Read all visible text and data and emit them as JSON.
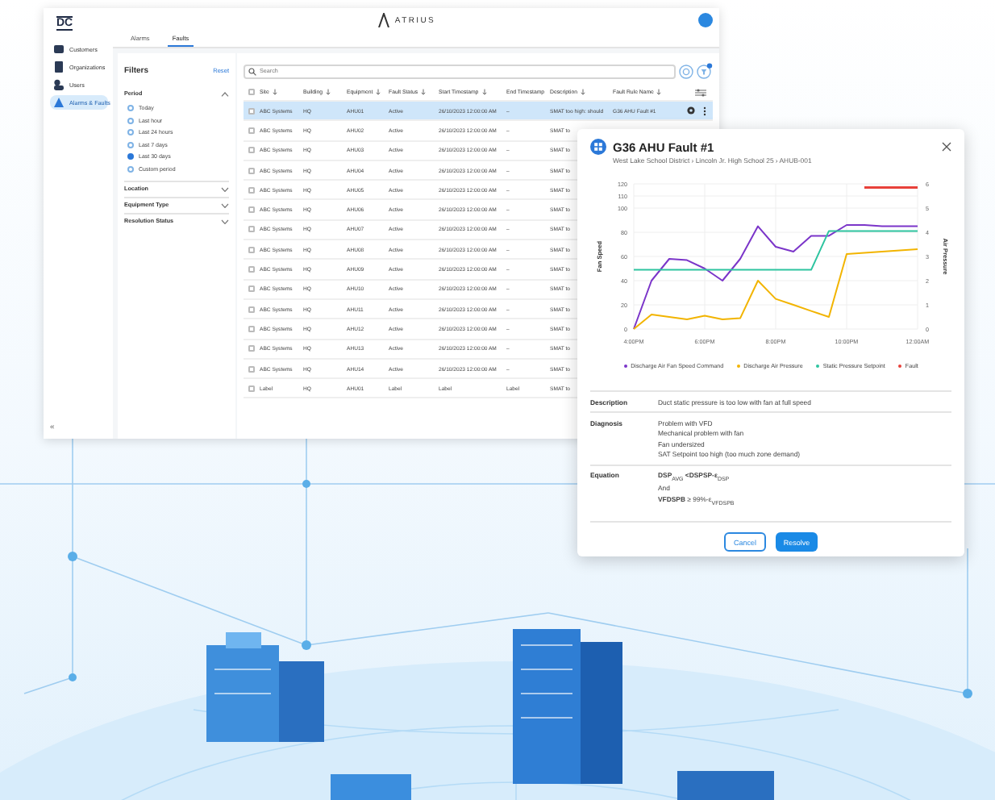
{
  "app": {
    "logo": "DC",
    "brand": "ATRIUS",
    "sidebar": {
      "items": [
        {
          "label": "Customers",
          "selected": false
        },
        {
          "label": "Organizations",
          "selected": false
        },
        {
          "label": "Users",
          "selected": false
        },
        {
          "label": "Alarms & Faults",
          "selected": true
        }
      ],
      "collapse": "«"
    },
    "tabs": [
      {
        "label": "Alarms",
        "selected": false
      },
      {
        "label": "Faults",
        "selected": true
      }
    ],
    "filters": {
      "title": "Filters",
      "reset": "Reset",
      "period": {
        "label": "Period",
        "expanded": true,
        "options": [
          {
            "label": "Today",
            "selected": false
          },
          {
            "label": "Last hour",
            "selected": false
          },
          {
            "label": "Last 24 hours",
            "selected": false
          },
          {
            "label": "Last 7 days",
            "selected": false
          },
          {
            "label": "Last 30 days",
            "selected": true
          },
          {
            "label": "Custom period",
            "selected": false
          }
        ]
      },
      "sections": [
        {
          "label": "Location",
          "expanded": false
        },
        {
          "label": "Equipment Type",
          "expanded": false
        },
        {
          "label": "Resolution Status",
          "expanded": false
        }
      ]
    },
    "table": {
      "search": {
        "placeholder": "Search"
      },
      "all_checked": false,
      "columns": [
        {
          "label": "Site",
          "sortable": true
        },
        {
          "label": "Building",
          "sortable": true
        },
        {
          "label": "Equipment",
          "sortable": true
        },
        {
          "label": "Fault Status",
          "sortable": true
        },
        {
          "label": "Start Timestamp",
          "sortable": true
        },
        {
          "label": "End Timestamp",
          "sortable": false
        },
        {
          "label": "Description",
          "sortable": true
        },
        {
          "label": "Fault Rule Name",
          "sortable": true
        }
      ],
      "rows": [
        {
          "selected": true,
          "checked": false,
          "cells": [
            "ABC Systems",
            "HQ",
            "AHU01",
            "Active",
            "26/10/2023 12:00:00 AM",
            "–",
            "SMAT too high: should",
            "G36 AHU Fault #1"
          ]
        },
        {
          "selected": false,
          "checked": false,
          "cells": [
            "ABC Systems",
            "HQ",
            "AHU02",
            "Active",
            "26/10/2023 12:00:00 AM",
            "–",
            "SMAT to"
          ]
        },
        {
          "selected": false,
          "checked": false,
          "cells": [
            "ABC Systems",
            "HQ",
            "AHU03",
            "Active",
            "26/10/2023 12:00:00 AM",
            "–",
            "SMAT to"
          ]
        },
        {
          "selected": false,
          "checked": false,
          "cells": [
            "ABC Systems",
            "HQ",
            "AHU04",
            "Active",
            "26/10/2023 12:00:00 AM",
            "–",
            "SMAT to"
          ]
        },
        {
          "selected": false,
          "checked": false,
          "cells": [
            "ABC Systems",
            "HQ",
            "AHU05",
            "Active",
            "26/10/2023 12:00:00 AM",
            "–",
            "SMAT to"
          ]
        },
        {
          "selected": false,
          "checked": false,
          "cells": [
            "ABC Systems",
            "HQ",
            "AHU06",
            "Active",
            "26/10/2023 12:00:00 AM",
            "–",
            "SMAT to"
          ]
        },
        {
          "selected": false,
          "checked": false,
          "cells": [
            "ABC Systems",
            "HQ",
            "AHU07",
            "Active",
            "26/10/2023 12:00:00 AM",
            "–",
            "SMAT to"
          ]
        },
        {
          "selected": false,
          "checked": false,
          "cells": [
            "ABC Systems",
            "HQ",
            "AHU08",
            "Active",
            "26/10/2023 12:00:00 AM",
            "–",
            "SMAT to"
          ]
        },
        {
          "selected": false,
          "checked": false,
          "cells": [
            "ABC Systems",
            "HQ",
            "AHU09",
            "Active",
            "26/10/2023 12:00:00 AM",
            "–",
            "SMAT to"
          ]
        },
        {
          "selected": false,
          "checked": false,
          "cells": [
            "ABC Systems",
            "HQ",
            "AHU10",
            "Active",
            "26/10/2023 12:00:00 AM",
            "–",
            "SMAT to"
          ]
        },
        {
          "selected": false,
          "checked": false,
          "cells": [
            "ABC Systems",
            "HQ",
            "AHU11",
            "Active",
            "26/10/2023 12:00:00 AM",
            "–",
            "SMAT to"
          ]
        },
        {
          "selected": false,
          "checked": false,
          "cells": [
            "ABC Systems",
            "HQ",
            "AHU12",
            "Active",
            "26/10/2023 12:00:00 AM",
            "–",
            "SMAT to"
          ]
        },
        {
          "selected": false,
          "checked": false,
          "cells": [
            "ABC Systems",
            "HQ",
            "AHU13",
            "Active",
            "26/10/2023 12:00:00 AM",
            "–",
            "SMAT to"
          ]
        },
        {
          "selected": false,
          "checked": false,
          "cells": [
            "ABC Systems",
            "HQ",
            "AHU14",
            "Active",
            "26/10/2023 12:00:00 AM",
            "–",
            "SMAT to"
          ]
        },
        {
          "selected": false,
          "checked": false,
          "cells": [
            "Label",
            "HQ",
            "AHU01",
            "Label",
            "Label",
            "Label",
            "SMAT to"
          ]
        }
      ]
    }
  },
  "modal": {
    "title": "G36 AHU Fault #1",
    "breadcrumb": "West Lake School District › Lincoln Jr. High School 25 › AHUB-001",
    "chart_data": {
      "type": "line",
      "grid": true,
      "legend": "bottom",
      "ylabel": "Fan Speed",
      "categories": [
        "4:00PM",
        null,
        null,
        null,
        "6:00PM",
        null,
        null,
        null,
        "8:00PM",
        null,
        null,
        null,
        "10:00PM",
        null,
        null,
        null,
        "12:00AM"
      ],
      "ylim": [
        0,
        120
      ],
      "yticks": [
        0,
        20,
        40,
        60,
        80,
        100,
        110,
        120
      ],
      "series": [
        {
          "name": "Discharge Air Fan Speed Command",
          "color": "#7b35c9",
          "values": [
            0,
            40,
            58,
            57,
            50,
            40,
            58,
            85,
            68,
            64,
            77,
            77,
            86,
            86,
            85,
            85,
            85
          ]
        },
        {
          "name": "Discharge Air Pressure",
          "color": "#f2b400",
          "values": [
            0,
            12,
            10,
            8,
            11,
            8,
            9,
            40,
            25,
            20,
            15,
            10,
            62,
            63,
            64,
            65,
            66
          ]
        },
        {
          "name": "Static Pressure Setpoint",
          "color": "#2ec4a0",
          "values": [
            49,
            49,
            49,
            49,
            49,
            49,
            49,
            49,
            49,
            49,
            49,
            81,
            81,
            81,
            81,
            81,
            81
          ]
        },
        {
          "name": "Fault",
          "color": "#e8403a",
          "values": [
            null,
            null,
            null,
            null,
            null,
            null,
            null,
            null,
            null,
            null,
            null,
            null,
            null,
            117,
            117,
            117,
            117
          ]
        }
      ]
    },
    "right_axis": {
      "label": "Air Pressure",
      "ticks": [
        "6",
        "5",
        "4",
        "3",
        "2",
        "1",
        "0"
      ]
    },
    "details": [
      {
        "label": "Description",
        "lines": [
          "Duct static pressure is too low with fan at full speed"
        ]
      },
      {
        "label": "Diagnosis",
        "lines": [
          "Problem with VFD",
          "Mechanical problem with fan",
          "Fan undersized",
          "SAT Setpoint too high (too much zone demand)"
        ]
      },
      {
        "label": "Equation",
        "lines": [
          "**DSP**$_{AVG}$ **<DSPSP-ε**$_{DSP}$",
          "And",
          "**VFDSPB** ≥ 99%-ε$_{VFDSPB}$"
        ]
      }
    ],
    "buttons": [
      {
        "label": "Cancel",
        "kind": "secondary"
      },
      {
        "label": "Resolve",
        "kind": "primary"
      }
    ]
  }
}
